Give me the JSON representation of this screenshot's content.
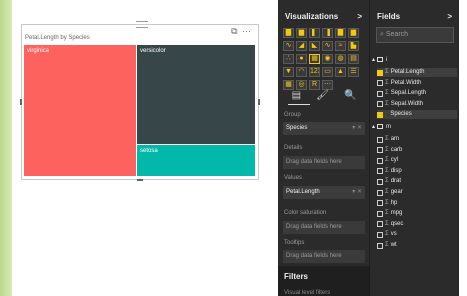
{
  "visual": {
    "title": "Petal.Length by Species",
    "header_icons": "⧉ ⋯",
    "treemap": [
      {
        "label": "virginica",
        "color": "#fd625e"
      },
      {
        "label": "versicolor",
        "color": "#374649"
      },
      {
        "label": "setosa",
        "color": "#01b8aa"
      }
    ]
  },
  "vizpane": {
    "title": "Visualizations",
    "collapse": ">",
    "icons": [
      "bar-chart",
      "stacked-bar",
      "column-chart",
      "stacked-column",
      "clustered-bar",
      "clustered-column",
      "line-chart",
      "area-chart",
      "stacked-area",
      "line-column",
      "ribbon",
      "waterfall",
      "scatter",
      "pie",
      "treemap",
      "map",
      "filled-map",
      "table",
      "funnel",
      "gauge",
      "card",
      "multirow-card",
      "kpi",
      "slicer",
      "matrix",
      "globe",
      "r-script",
      "more"
    ],
    "icon_glyphs": [
      "▇",
      "▆",
      "▌",
      "▐",
      "▇",
      "▆",
      "∿",
      "◢",
      "◣",
      "∿",
      "≈",
      "▙",
      "∴",
      "●",
      "▦",
      "◉",
      "◍",
      "▤",
      "▼",
      "◠",
      "123",
      "▭",
      "▲",
      "☰",
      "▦",
      "◎",
      "R",
      "⋯"
    ],
    "tools": [
      "fields-tool",
      "format-tool",
      "analytics-tool"
    ],
    "tool_glyphs": [
      "▤",
      "🖌",
      "🔍"
    ],
    "group_label": "Group",
    "group_value": "Species",
    "details_label": "Details",
    "details_placeholder": "Drag data fields here",
    "values_label": "Values",
    "values_value": "Petal.Length",
    "color_sat_label": "Color saturation",
    "color_sat_placeholder": "Drag data fields here",
    "tooltips_label": "Tooltips",
    "tooltips_placeholder": "Drag data fields here",
    "well_controls": "▾ ✕"
  },
  "filters": {
    "title": "Filters",
    "subtitle": "Visual level filters"
  },
  "fieldpane": {
    "title": "Fields",
    "collapse": ">",
    "search_placeholder": "Search",
    "tables": [
      {
        "name": "i",
        "fields": [
          {
            "name": "Petal.Length",
            "sigma": true,
            "checked": true
          },
          {
            "name": "Petal.Width",
            "sigma": true,
            "checked": false
          },
          {
            "name": "Sepal.Length",
            "sigma": true,
            "checked": false
          },
          {
            "name": "Sepal.Width",
            "sigma": true,
            "checked": false
          },
          {
            "name": "Species",
            "sigma": false,
            "checked": true
          }
        ]
      },
      {
        "name": "m",
        "fields": [
          {
            "name": "am",
            "sigma": true,
            "checked": false
          },
          {
            "name": "carb",
            "sigma": true,
            "checked": false
          },
          {
            "name": "cyl",
            "sigma": true,
            "checked": false
          },
          {
            "name": "disp",
            "sigma": true,
            "checked": false
          },
          {
            "name": "drat",
            "sigma": true,
            "checked": false
          },
          {
            "name": "gear",
            "sigma": true,
            "checked": false
          },
          {
            "name": "hp",
            "sigma": true,
            "checked": false
          },
          {
            "name": "mpg",
            "sigma": true,
            "checked": false
          },
          {
            "name": "qsec",
            "sigma": true,
            "checked": false
          },
          {
            "name": "vs",
            "sigma": true,
            "checked": false
          },
          {
            "name": "wt",
            "sigma": true,
            "checked": false
          }
        ]
      }
    ]
  }
}
